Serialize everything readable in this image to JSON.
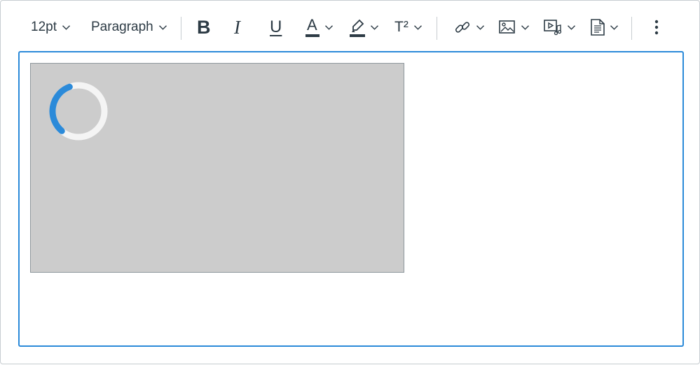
{
  "toolbar": {
    "font_size": "12pt",
    "block_format": "Paragraph",
    "buttons": {
      "bold": "B",
      "italic": "I",
      "underline": "U",
      "text_color": "A",
      "superscript": "T²"
    },
    "icons": [
      "chevron-down-icon",
      "bold-icon",
      "italic-icon",
      "underline-icon",
      "text-color-icon",
      "highlight-icon",
      "superscript-icon",
      "link-icon",
      "image-icon",
      "media-icon",
      "document-icon",
      "more-vertical-icon"
    ]
  },
  "editor": {
    "state": "loading",
    "content": "image-placeholder"
  },
  "colors": {
    "accent": "#2b8ad9",
    "spinner": "#2b8ad9",
    "placeholder_bg": "#cccccc",
    "text": "#2d3b45",
    "border": "#c7cdd1"
  }
}
